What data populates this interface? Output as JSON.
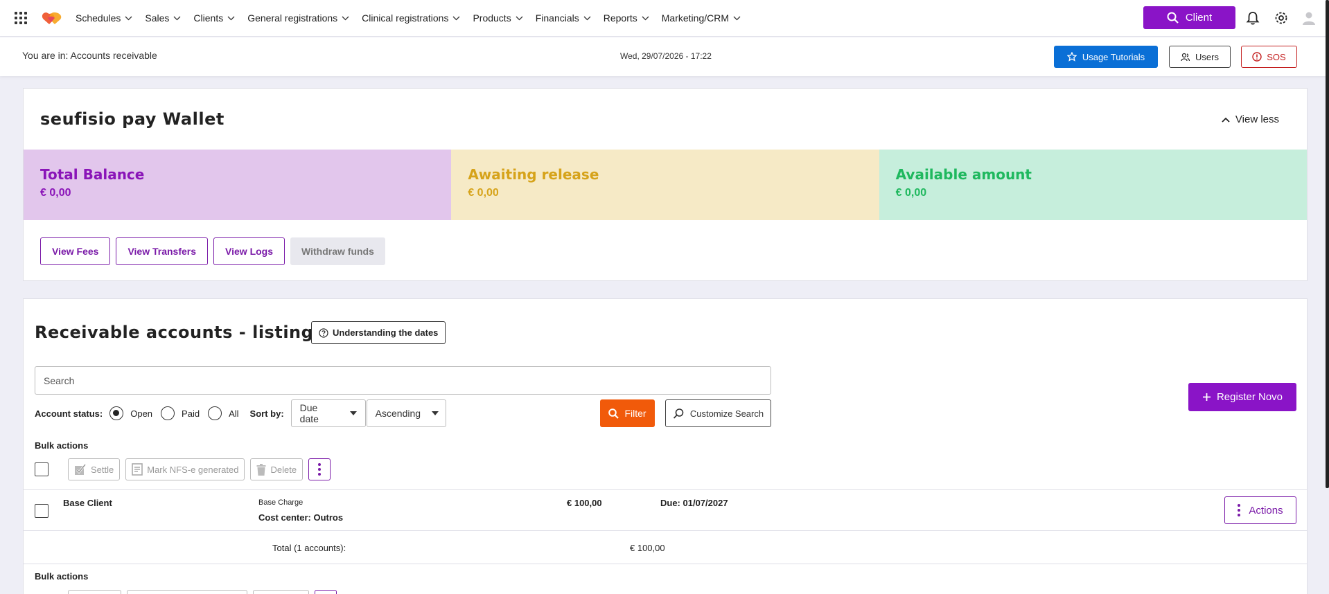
{
  "topnav": {
    "menu": [
      {
        "label": "Schedules"
      },
      {
        "label": "Sales"
      },
      {
        "label": "Clients"
      },
      {
        "label": "General registrations"
      },
      {
        "label": "Clinical registrations"
      },
      {
        "label": "Products"
      },
      {
        "label": "Financials"
      },
      {
        "label": "Reports"
      },
      {
        "label": "Marketing/CRM"
      }
    ],
    "client_button": "Client",
    "icons": [
      "apps-grid-icon",
      "bell-icon",
      "gear-icon",
      "user-avatar-icon"
    ]
  },
  "subheader": {
    "breadcrumb": "You are in: Accounts receivable",
    "datetime": "Wed, 29/07/2026 - 17:22",
    "usage_tutorials": "Usage Tutorials",
    "users": "Users",
    "sos": "SOS"
  },
  "wallet": {
    "title": "seufisio pay Wallet",
    "view_less": "View less",
    "tiles": [
      {
        "title": "Total Balance",
        "value": "€ 0,00",
        "bg": "#e2c6ec",
        "color": "#8a14b8"
      },
      {
        "title": "Awaiting release",
        "value": "€ 0,00",
        "bg": "#f6eac6",
        "color": "#d6a31a"
      },
      {
        "title": "Available amount",
        "value": "€ 0,00",
        "bg": "#c6eedc",
        "color": "#1fb85e"
      }
    ],
    "actions": {
      "view_fees": "View Fees",
      "view_transfers": "View Transfers",
      "view_logs": "View Logs",
      "withdraw_funds": "Withdraw funds"
    }
  },
  "listing": {
    "title": "Receivable accounts - listing",
    "understanding_dates": "Understanding the dates",
    "search_placeholder": "Search",
    "account_status_label": "Account status:",
    "status_options": [
      {
        "label": "Open",
        "selected": true
      },
      {
        "label": "Paid",
        "selected": false
      },
      {
        "label": "All",
        "selected": false
      }
    ],
    "sort_by_label": "Sort by:",
    "sort_field": "Due date",
    "sort_order": "Ascending",
    "filter": "Filter",
    "customize_search": "Customize Search",
    "register_new": "Register Novo",
    "bulk_actions_label": "Bulk actions",
    "bulk": {
      "settle": "Settle",
      "mark_nfse": "Mark NFS-e generated",
      "delete": "Delete"
    },
    "rows": [
      {
        "client": "Base Client",
        "charge": "Base Charge",
        "cost_center": "Cost center: Outros",
        "amount": "€ 100,00",
        "due": "Due: 01/07/2027",
        "actions": "Actions"
      }
    ],
    "total_label": "Total (1 accounts):",
    "total_value": "€ 100,00",
    "bulk_actions_label_bottom": "Bulk actions"
  },
  "colors": {
    "brand_purple": "#8a14c7",
    "primary_blue": "#0a6fd6",
    "filter_orange": "#f15a0a",
    "sos_red": "#c42020"
  }
}
